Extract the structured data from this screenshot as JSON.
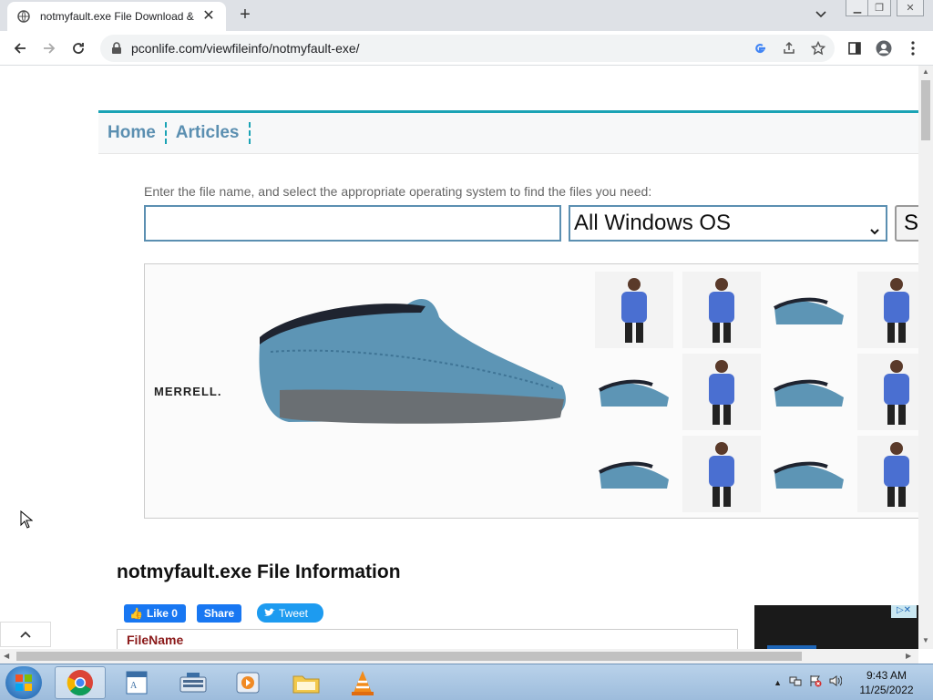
{
  "browser": {
    "tab_title": "notmyfault.exe File Download &",
    "url": "pconlife.com/viewfileinfo/notmyfault-exe/"
  },
  "nav": {
    "links": [
      "Home",
      "Articles"
    ]
  },
  "search": {
    "label": "Enter the file name, and select the appropriate operating system to find the files you need:",
    "input_value": "",
    "os_selected": "All Windows OS",
    "button_label": "S"
  },
  "ad": {
    "brand": "MERRELL."
  },
  "file": {
    "heading": "notmyfault.exe File Information",
    "like_label": "Like 0",
    "share_label": "Share",
    "tweet_label": "Tweet",
    "table_first_label": "FileName"
  },
  "taskbar": {
    "time": "9:43 AM",
    "date": "11/25/2022"
  },
  "colors": {
    "accent": "#1aa3b5",
    "link": "#5b8fb1",
    "facebook": "#1877f2",
    "twitter": "#1d9bf0"
  }
}
